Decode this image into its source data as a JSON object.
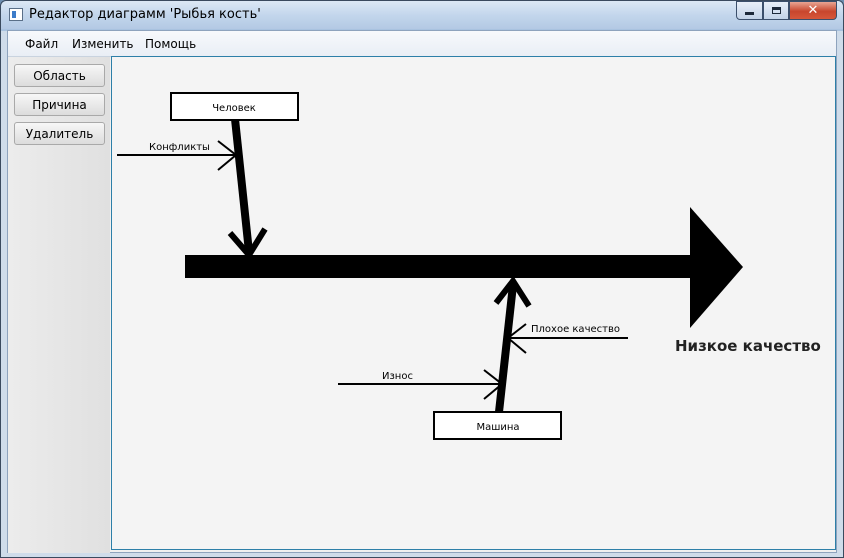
{
  "window": {
    "title": "Редактор диаграмм 'Рыбья кость'",
    "close_glyph": "✕"
  },
  "menu": {
    "items": [
      "Файл",
      "Изменить",
      "Помощь"
    ]
  },
  "toolbox": {
    "buttons": [
      "Область",
      "Причина",
      "Удалитель"
    ]
  },
  "diagram": {
    "effect_label": "Низкое качество",
    "causes": [
      {
        "label": "Человек",
        "sub_causes": [
          "Конфликты"
        ]
      },
      {
        "label": "Машина",
        "sub_causes": [
          "Плохое качество",
          "Износ"
        ]
      }
    ]
  },
  "colors": {
    "canvas_bg": "#f4f4f4",
    "canvas_border": "#2d7fa8",
    "diagram_stroke": "#000000"
  }
}
